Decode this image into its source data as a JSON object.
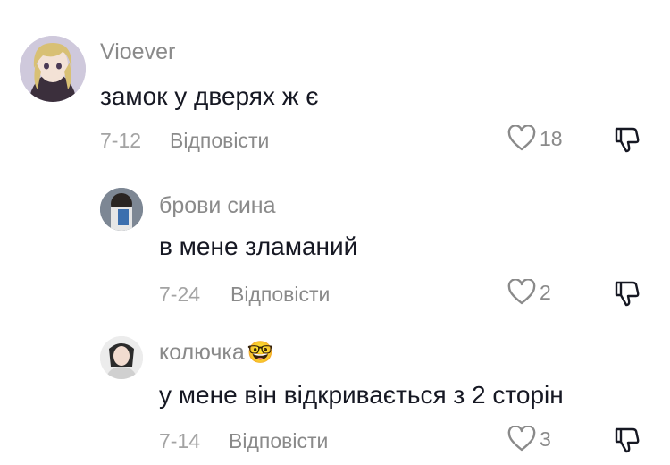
{
  "comments": [
    {
      "username": "Vioever",
      "text": "замок у дверях ж є",
      "date": "7-12",
      "reply_label": "Відповісти",
      "likes": "18"
    },
    {
      "username": "брови сина",
      "text": "в мене зламаний",
      "date": "7-24",
      "reply_label": "Відповісти",
      "likes": "2"
    },
    {
      "username": "колючка",
      "username_emoji": "🤓",
      "text": "у мене він відкривається з 2 сторін",
      "date": "7-14",
      "reply_label": "Відповісти",
      "likes": "3"
    }
  ],
  "icons": {
    "like": "heart-outline-icon",
    "dislike": "thumbs-down-outline-icon"
  },
  "colors": {
    "text": "#161823",
    "secondary": "#8a8a8a"
  }
}
